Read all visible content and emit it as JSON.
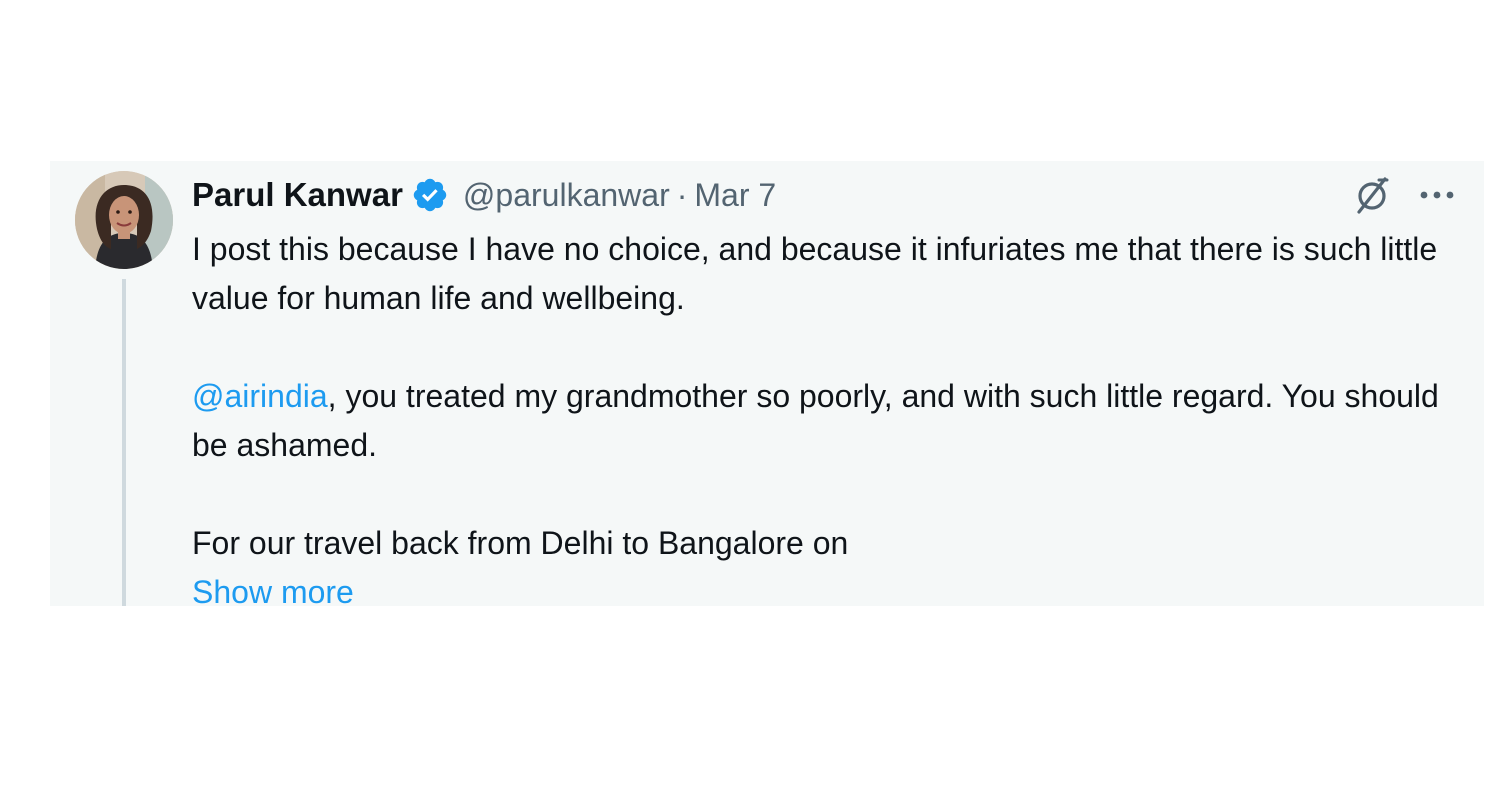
{
  "tweet": {
    "author_name": "Parul Kanwar",
    "handle": "@parulkanwar",
    "separator": "·",
    "date": "Mar 7",
    "paragraph_1": "I post this because I have no choice, and because it infuriates me that there is such little value for human life and wellbeing.",
    "mention": "@airindia",
    "paragraph_2_rest": ", you treated my grandmother so poorly, and with such little regard. You should be ashamed.",
    "paragraph_3": "For our travel back from Delhi to Bangalore on",
    "show_more_label": "Show more"
  },
  "icons": {
    "verified": "verified-badge-icon",
    "grok": "grok-icon",
    "more": "more-options-icon"
  },
  "colors": {
    "card_background": "#f5f8f8",
    "link": "#1d9bf0",
    "text_primary": "#0f1419",
    "text_secondary": "#536471",
    "verified": "#1d9bf0"
  }
}
